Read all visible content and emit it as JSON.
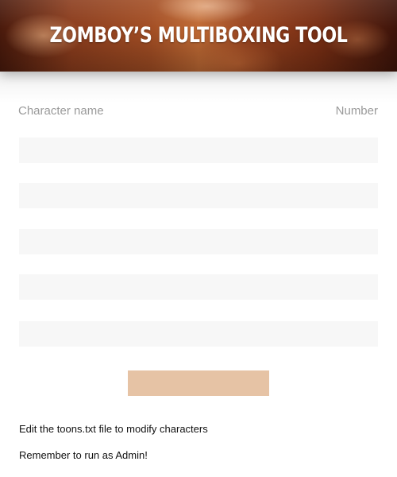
{
  "header": {
    "title": "ZOMBOY’S MULTIBOXING TOOL"
  },
  "columns": {
    "left": "Character name",
    "right": "Number"
  },
  "rows": [
    {
      "value": ""
    },
    {
      "value": ""
    },
    {
      "value": ""
    },
    {
      "value": ""
    },
    {
      "value": ""
    }
  ],
  "action_button": {
    "label": ""
  },
  "notes": [
    "Edit the toons.txt file to modify characters",
    "Remember to run as Admin!"
  ],
  "colors": {
    "button": "#e6c3a5",
    "row_background": "#f7f7f7",
    "header_dark": "#4a1a0c",
    "header_light": "#c06a34"
  }
}
